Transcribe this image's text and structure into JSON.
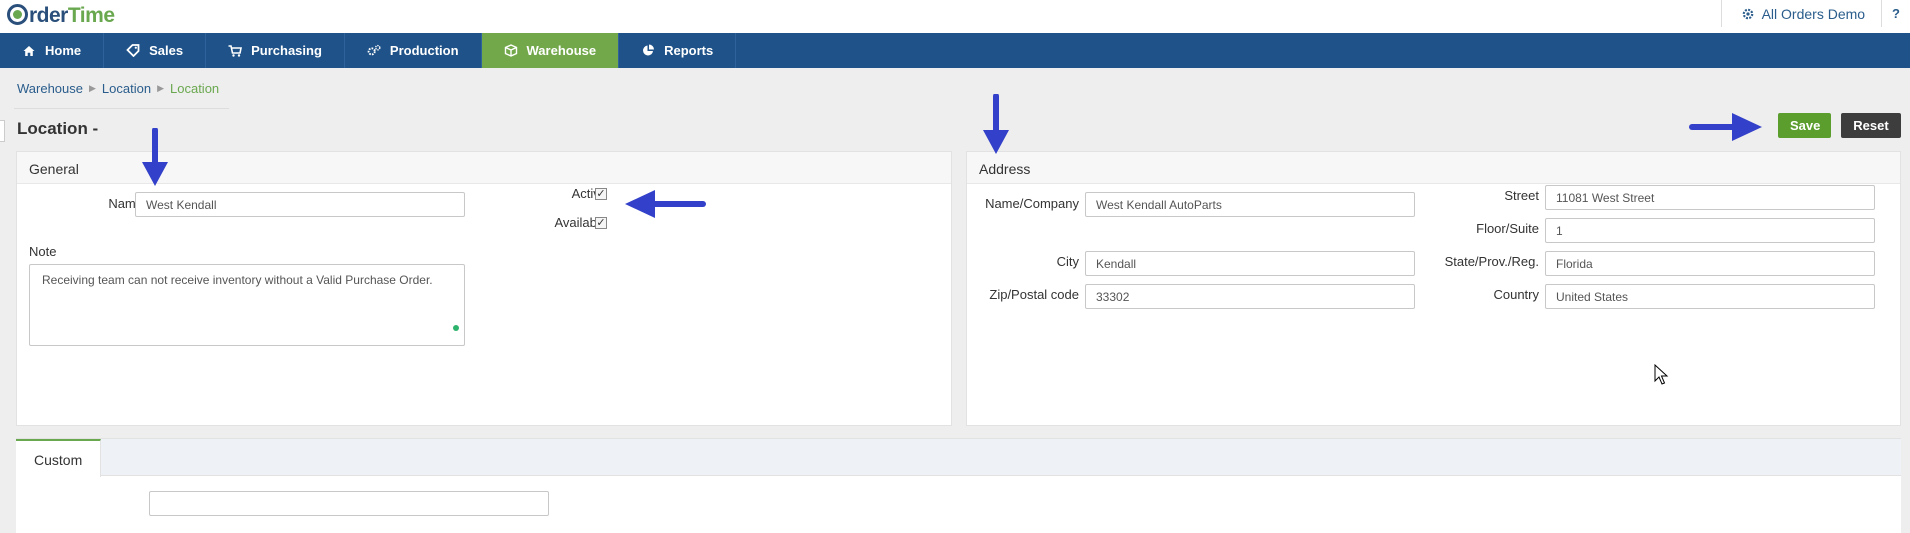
{
  "brand": {
    "logo_o": "O",
    "logo_rder": "rder",
    "logo_time": "Time"
  },
  "header": {
    "company": "All Orders Demo",
    "help": "?"
  },
  "nav": {
    "items": [
      {
        "label": "Home",
        "icon": "home-icon"
      },
      {
        "label": "Sales",
        "icon": "tag-icon"
      },
      {
        "label": "Purchasing",
        "icon": "cart-icon"
      },
      {
        "label": "Production",
        "icon": "gears-icon"
      },
      {
        "label": "Warehouse",
        "icon": "cube-icon",
        "active": true
      },
      {
        "label": "Reports",
        "icon": "pie-chart-icon"
      }
    ]
  },
  "breadcrumb": [
    "Warehouse",
    "Location",
    "Location"
  ],
  "page": {
    "title": "Location -"
  },
  "actions": {
    "save": "Save",
    "reset": "Reset"
  },
  "general": {
    "heading": "General",
    "name_label": "Name",
    "name_value": "West Kendall",
    "active_label": "Active",
    "available_label": "Available",
    "note_label": "Note",
    "note_value": "Receiving team can not receive inventory without a Valid Purchase Order."
  },
  "address": {
    "heading": "Address",
    "name_company_label": "Name/Company",
    "name_company_value": "West Kendall AutoParts",
    "street_label": "Street",
    "street_value": "11081 West Street",
    "floor_label": "Floor/Suite",
    "floor_value": "1",
    "city_label": "City",
    "city_value": "Kendall",
    "state_label": "State/Prov./Reg.",
    "state_value": "Florida",
    "zip_label": "Zip/Postal code",
    "zip_value": "33302",
    "country_label": "Country",
    "country_value": "United States"
  },
  "custom": {
    "tab_label": "Custom",
    "field_value": ""
  },
  "colors": {
    "nav": "#1e5288",
    "nav_active": "#72a84a",
    "save": "#5c9e2e",
    "reset": "#3d3d3d",
    "annotation_arrow": "#3340c9"
  }
}
